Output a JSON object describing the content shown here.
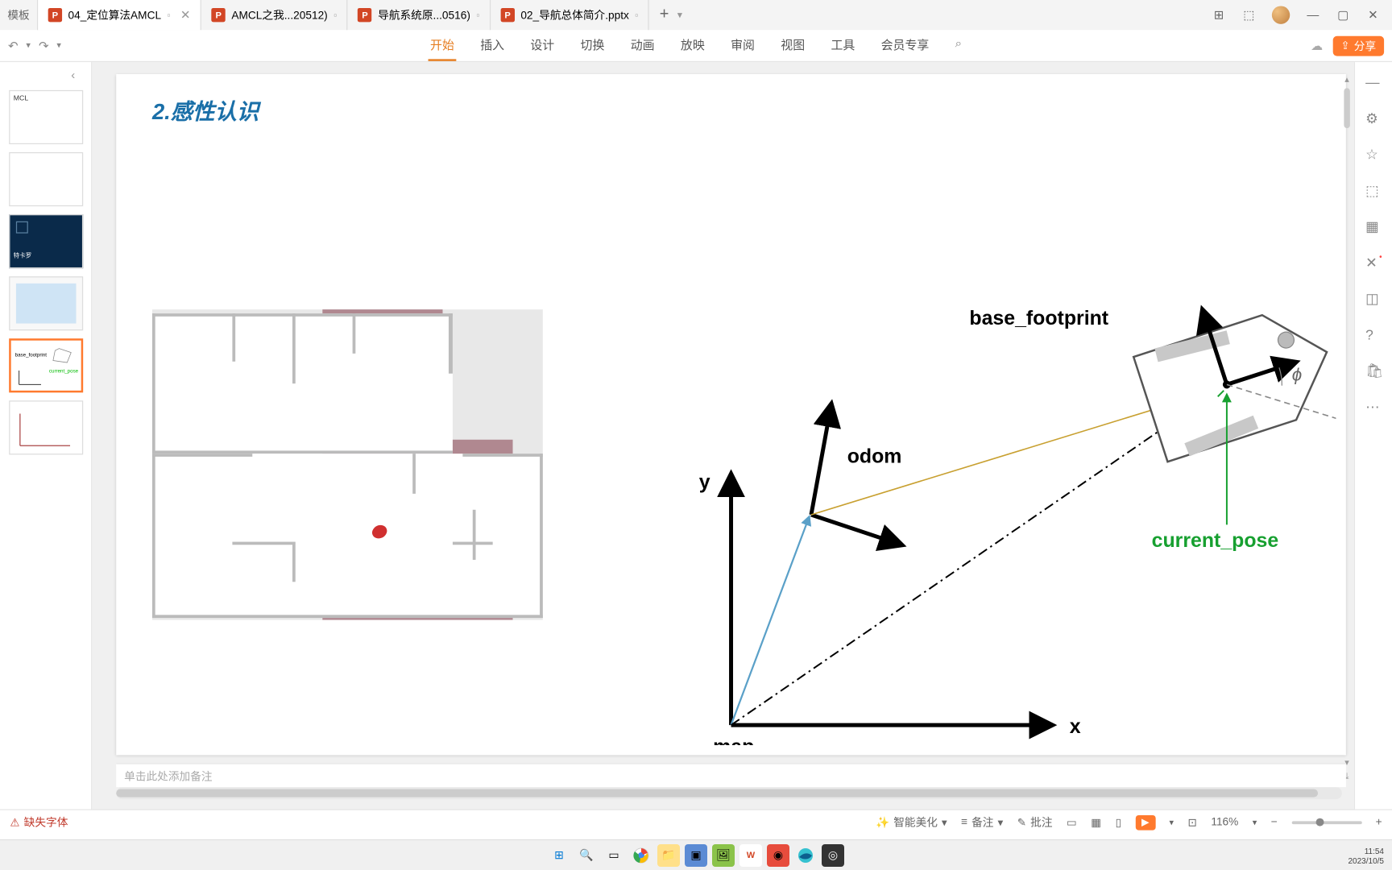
{
  "tabbar": {
    "templates_label": "模板",
    "tabs": [
      {
        "label": "04_定位算法AMCL",
        "active": true
      },
      {
        "label": "AMCL之我...20512)",
        "active": false
      },
      {
        "label": "导航系统原...0516)",
        "active": false
      },
      {
        "label": "02_导航总体简介.pptx",
        "active": false
      }
    ]
  },
  "menubar": {
    "items": [
      "开始",
      "插入",
      "设计",
      "切换",
      "动画",
      "放映",
      "审阅",
      "视图",
      "工具",
      "会员专享"
    ],
    "active": "开始",
    "share": "分享"
  },
  "slide": {
    "title": "2.感性认识",
    "notes_placeholder": "单击此处添加备注",
    "diagram": {
      "base_footprint": "base_footprint",
      "odom": "odom",
      "current_pose": "current_pose",
      "map": "map",
      "x": "x",
      "y": "y",
      "phi": "ϕ"
    }
  },
  "thumbs": {
    "t1": "MCL",
    "t3": "特卡罗"
  },
  "status": {
    "missing_font": "缺失字体",
    "beautify": "智能美化",
    "notes": "备注",
    "comments": "批注",
    "zoom": "116%"
  },
  "clock": {
    "time": "11:54",
    "date": "2023/10/5"
  },
  "icons": {
    "search": "⌕",
    "cloud": "☁",
    "minus": "—",
    "square": "▢",
    "close": "✕",
    "cube": "⬚",
    "chevron_left": "‹",
    "plus": "+",
    "dropdown": "▾",
    "undo": "↶",
    "redo": "↷"
  }
}
